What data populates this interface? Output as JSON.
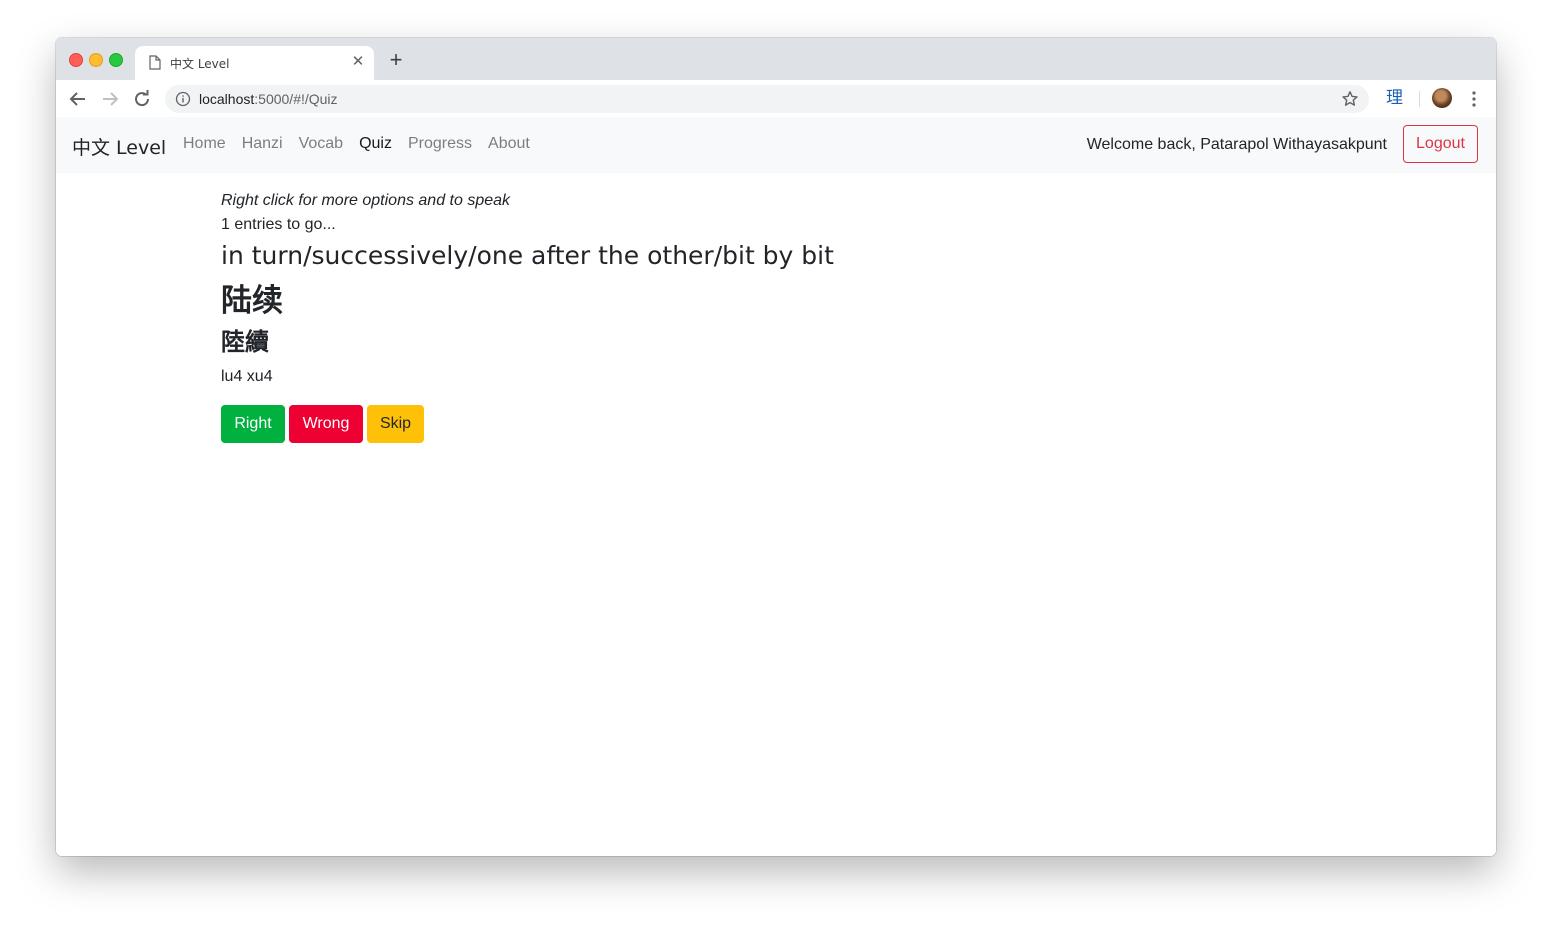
{
  "browser": {
    "tab_title": "中文 Level",
    "url_host": "localhost",
    "url_path": ":5000/#!/Quiz",
    "extension_label": "理"
  },
  "navbar": {
    "brand": "中文 Level",
    "links": [
      {
        "label": "Home",
        "active": false
      },
      {
        "label": "Hanzi",
        "active": false
      },
      {
        "label": "Vocab",
        "active": false
      },
      {
        "label": "Quiz",
        "active": true
      },
      {
        "label": "Progress",
        "active": false
      },
      {
        "label": "About",
        "active": false
      }
    ],
    "welcome": "Welcome back, Patarapol Withayasakpunt",
    "logout_label": "Logout"
  },
  "quiz": {
    "hint": "Right click for more options and to speak",
    "remaining": "1 entries to go...",
    "english": "in turn/successively/one after the other/bit by bit",
    "simplified": "陆续",
    "traditional": "陸續",
    "pinyin": "lu4 xu4",
    "buttons": {
      "right": "Right",
      "wrong": "Wrong",
      "skip": "Skip"
    }
  },
  "colors": {
    "right": "#00b140",
    "wrong": "#ee0033",
    "skip": "#ffc107",
    "logout": "#dc3545"
  }
}
